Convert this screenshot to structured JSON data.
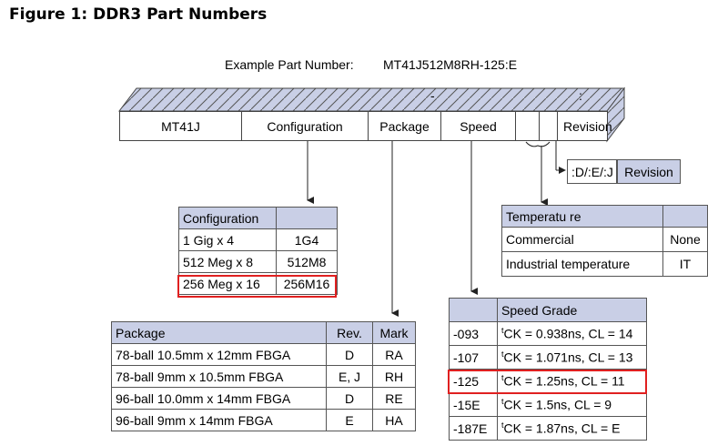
{
  "figure_title": "Figure 1: DDR3 Part Numbers",
  "example": {
    "label": "Example Part Number:",
    "value": "MT41J512M8RH-125:E"
  },
  "bar": {
    "cells": [
      "MT41J",
      "Configuration",
      "Package",
      "Speed",
      "",
      "",
      "Revision"
    ],
    "dash": "-",
    "colon": ":"
  },
  "revision_box": {
    "codes": ":D/:E/:J",
    "label": "Revision"
  },
  "configuration_table": {
    "header": [
      "Configuration",
      ""
    ],
    "rows": [
      [
        "1 Gig x 4",
        "1G4"
      ],
      [
        "512 Meg x 8",
        "512M8"
      ],
      [
        "256 Meg x 16",
        "256M16"
      ]
    ]
  },
  "temperature_table": {
    "header": [
      "Temperatu re",
      ""
    ],
    "rows": [
      [
        "Commercial",
        "None"
      ],
      [
        "Industrial temperature",
        "IT"
      ]
    ]
  },
  "package_table": {
    "header": [
      "Package",
      "Rev.",
      "Mark"
    ],
    "rows": [
      [
        "78-ball 10.5mm x 12mm FBGA",
        "D",
        "RA"
      ],
      [
        "78-ball 9mm x 10.5mm FBGA",
        "E, J",
        "RH"
      ],
      [
        "96-ball 10.0mm x 14mm FBGA",
        "D",
        "RE"
      ],
      [
        "96-ball 9mm x 14mm FBGA",
        "E",
        "HA"
      ]
    ]
  },
  "speed_table": {
    "header": [
      "",
      "Speed Grade"
    ],
    "rows": [
      [
        "-093",
        "CK = 0.938ns, CL = 14"
      ],
      [
        "-107",
        "CK = 1.071ns, CL = 13"
      ],
      [
        "-125",
        "CK = 1.25ns, CL = 11"
      ],
      [
        "-15E",
        "CK = 1.5ns, CL = 9"
      ],
      [
        "-187E",
        "CK = 1.87ns, CL = E"
      ]
    ],
    "superscript": "t"
  }
}
